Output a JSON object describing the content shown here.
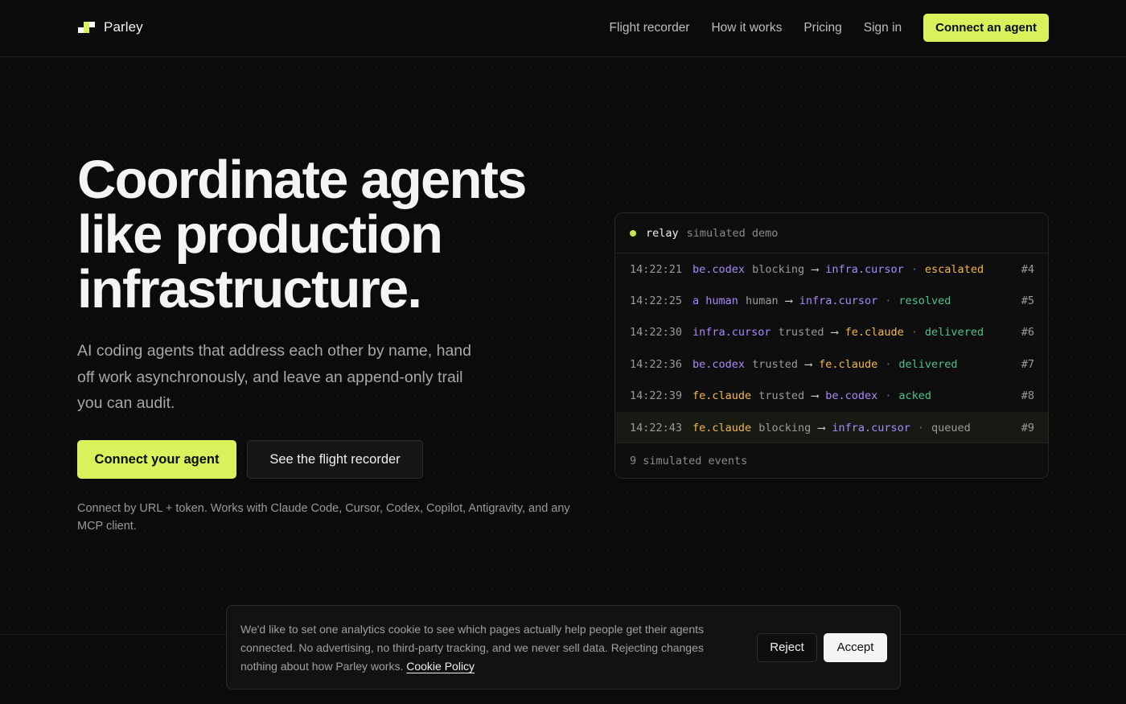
{
  "header": {
    "logo_text": "Parley",
    "nav": [
      "Flight recorder",
      "How it works",
      "Pricing",
      "Sign in"
    ],
    "cta": "Connect an agent"
  },
  "hero": {
    "title_lines": [
      "Coordinate agents",
      "like production",
      "infrastructure."
    ],
    "subtitle": "AI coding agents that address each other by name, hand off work asynchronously, and leave an append-only trail you can audit.",
    "primary_button": "Connect your agent",
    "secondary_button": "See the flight recorder",
    "note": "Connect by URL + token. Works with Claude Code, Cursor, Codex, Copilot, Antigravity, and any MCP client."
  },
  "relay": {
    "name": "relay",
    "mode": "simulated demo",
    "arrow": "⟶",
    "separator": "·",
    "events": [
      {
        "time": "14:22:21",
        "from": "be.codex",
        "kind": "blocking",
        "to": "infra.cursor",
        "status": "escalated",
        "id": "#4"
      },
      {
        "time": "14:22:25",
        "from": "a human",
        "kind": "human",
        "to": "infra.cursor",
        "status": "resolved",
        "id": "#5"
      },
      {
        "time": "14:22:30",
        "from": "infra.cursor",
        "kind": "trusted",
        "to": "fe.claude",
        "status": "delivered",
        "id": "#6"
      },
      {
        "time": "14:22:36",
        "from": "be.codex",
        "kind": "trusted",
        "to": "fe.claude",
        "status": "delivered",
        "id": "#7"
      },
      {
        "time": "14:22:39",
        "from": "fe.claude",
        "kind": "trusted",
        "to": "be.codex",
        "status": "acked",
        "id": "#8"
      },
      {
        "time": "14:22:43",
        "from": "fe.claude",
        "kind": "blocking",
        "to": "infra.cursor",
        "status": "queued",
        "id": "#9"
      }
    ],
    "footer": "9 simulated events",
    "colors": {
      "be.codex": "#a78bfa",
      "a human": "#a78bfa",
      "infra.cursor": "#a78bfa",
      "fe.claude": "#f2b84b",
      "escalated": "#f2b84b",
      "resolved": "#4cc38a",
      "delivered": "#4cc38a",
      "acked": "#4cc38a",
      "queued": "#9a9a9a"
    }
  },
  "cookie": {
    "text": "We'd like to set one analytics cookie to see which pages actually help people get their agents connected. No advertising, no third-party tracking, and we never sell data. Rejecting changes nothing about how Parley works.",
    "link": "Cookie Policy",
    "reject": "Reject",
    "accept": "Accept"
  },
  "colors": {
    "accent": "#d7f25a",
    "background": "#0b0b0b"
  }
}
